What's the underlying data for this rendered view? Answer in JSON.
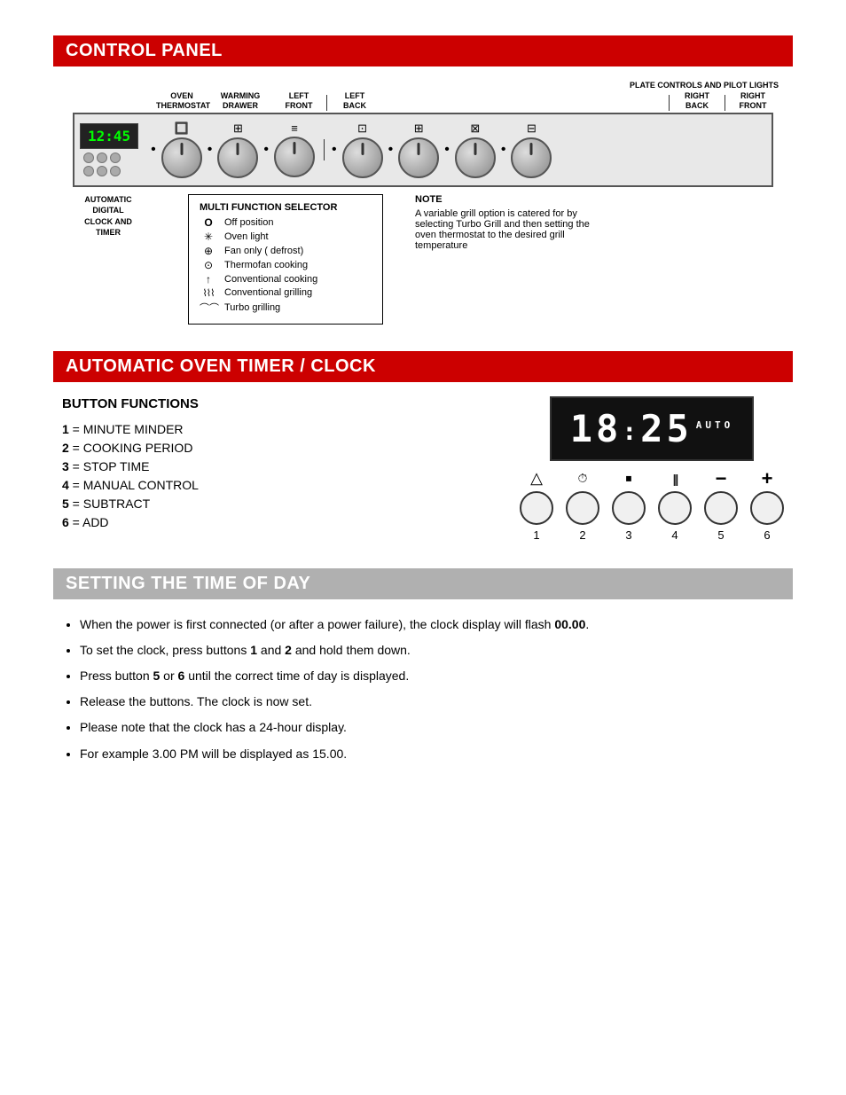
{
  "control_panel": {
    "title": "CONTROL PANEL",
    "labels": {
      "oven_thermostat": "OVEN\nTHERMOSTAT",
      "warming_drawer": "WARMING\nDRAWER",
      "left_front": "LEFT\nFRONT",
      "left_back": "LEFT\nBACK",
      "right_back": "RIGHT\nBACK",
      "right_front": "RIGHT\nFRONT",
      "plate_controls": "PLATE CONTROLS AND PILOT LIGHTS"
    },
    "clock_time": "12:45",
    "auto_digital_label": "AUTOMATIC\nDIGITAL\nCLOCK AND\nTIMER",
    "mfs": {
      "title": "MULTI FUNCTION SELECTOR",
      "items": [
        {
          "symbol": "O",
          "label": "Off position"
        },
        {
          "symbol": "☀",
          "label": "Oven light"
        },
        {
          "symbol": "⊕",
          "label": "Fan only ( defrost)"
        },
        {
          "symbol": "⊙",
          "label": "Thermofan cooking"
        },
        {
          "symbol": "↑",
          "label": "Conventional cooking"
        },
        {
          "symbol": "⌇⌇⌇",
          "label": "Conventional grilling"
        },
        {
          "symbol": "⌒⌒",
          "label": "Turbo grilling"
        }
      ]
    },
    "note": {
      "title": "NOTE",
      "text": "A variable grill option is catered for by selecting Turbo Grill and then setting the oven thermostat to the desired grill temperature"
    }
  },
  "timer_section": {
    "title": "AUTOMATIC OVEN TIMER / CLOCK",
    "button_functions_title": "BUTTON FUNCTIONS",
    "buttons": [
      {
        "number": "1",
        "label": "MINUTE MINDER"
      },
      {
        "number": "2",
        "label": "COOKING PERIOD"
      },
      {
        "number": "3",
        "label": "STOP TIME"
      },
      {
        "number": "4",
        "label": "MANUAL CONTROL"
      },
      {
        "number": "5",
        "label": "SUBTRACT"
      },
      {
        "number": "6",
        "label": "ADD"
      }
    ],
    "display": "18:25",
    "display_auto": "AUTO",
    "button_numbers": [
      "1",
      "2",
      "3",
      "4",
      "5",
      "6"
    ],
    "button_icons": [
      "△",
      "⏱",
      "⏹",
      "|||",
      "−",
      "+"
    ]
  },
  "setting_time": {
    "title": "SETTING THE TIME OF DAY",
    "bullets": [
      "When the power is first connected (or after a power failure), the clock display will flash 00.00.",
      "To set the clock, press buttons 1 and 2 and hold them down.",
      "Press button 5 or 6 until the correct time of day is displayed.",
      "Release the buttons. The clock is now set.",
      "Please note that the clock has a 24-hour display.",
      "For example 3.00 PM will be displayed as 15.00."
    ],
    "bullet_bold_parts": [
      "00.00",
      "1",
      "2",
      "5",
      "6"
    ]
  }
}
